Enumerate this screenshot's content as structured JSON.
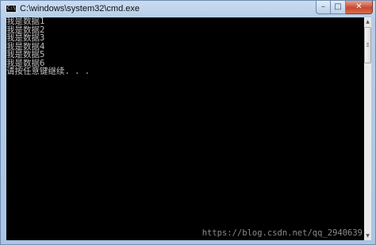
{
  "window": {
    "title": "C:\\windows\\system32\\cmd.exe",
    "icon": "console-icon",
    "icon_glyph": "C:\\",
    "controls": {
      "minimize_glyph": "–",
      "maximize_glyph": "□",
      "close_glyph": "✕"
    }
  },
  "console": {
    "background": "#000000",
    "text_color": "#c0c0c0",
    "lines": [
      "我是数据1",
      "我是数据2",
      "我是数据3",
      "我是数据4",
      "我是数据5",
      "我是数据6",
      "请按任意键继续. . ."
    ],
    "watermark": "https://blog.csdn.net/qq_2940639"
  },
  "scrollbar": {
    "up_glyph": "▲",
    "down_glyph": "▼"
  }
}
